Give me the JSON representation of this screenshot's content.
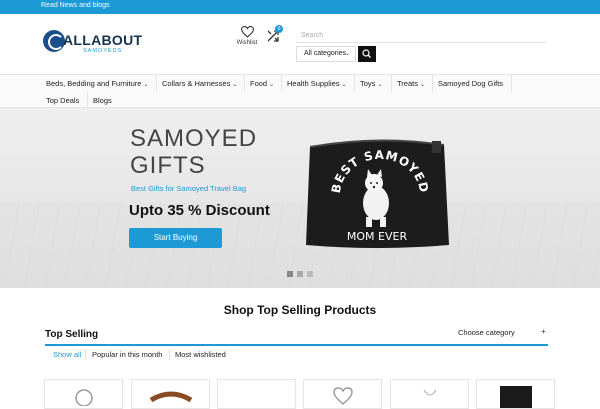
{
  "topbar": {
    "text": "Read News and blogs"
  },
  "brand": {
    "name": "ALLABOUT",
    "sub": "SAMOYEDS",
    "accent": "#1d9ad6"
  },
  "header": {
    "wishlist_label": "Wishlist",
    "compare_count": "0",
    "search_placeholder": "Search",
    "category_select": "All categories"
  },
  "nav": {
    "items": [
      {
        "label": "Beds, Bedding and Furniture",
        "has_dropdown": true
      },
      {
        "label": "Collars & Harnesses",
        "has_dropdown": true
      },
      {
        "label": "Food",
        "has_dropdown": true
      },
      {
        "label": "Health Supplies",
        "has_dropdown": true
      },
      {
        "label": "Toys",
        "has_dropdown": true
      },
      {
        "label": "Treats",
        "has_dropdown": true
      },
      {
        "label": "Samoyed Dog Gifts",
        "has_dropdown": false
      },
      {
        "label": "Top Deals",
        "has_dropdown": false
      },
      {
        "label": "Blogs",
        "has_dropdown": false
      }
    ]
  },
  "hero": {
    "title_line1": "SAMOYED",
    "title_line2": "GIFTS",
    "subtitle": "Best Gifts for Samoyed Travel Bag",
    "discount": "Upto 35 % Discount",
    "button": "Start Buying",
    "bag_text_top": "BEST SAMOYED",
    "bag_text_bottom": "MOM EVER",
    "slide_count": 3,
    "active_slide": 1
  },
  "products_section": {
    "title": "Shop Top Selling Products",
    "subtitle": "Top Selling",
    "category_select": "Choose category",
    "tabs": [
      "Show all",
      "Popular in this month",
      "Most wishlisted"
    ],
    "active_tab": 0,
    "card_count": 6
  }
}
